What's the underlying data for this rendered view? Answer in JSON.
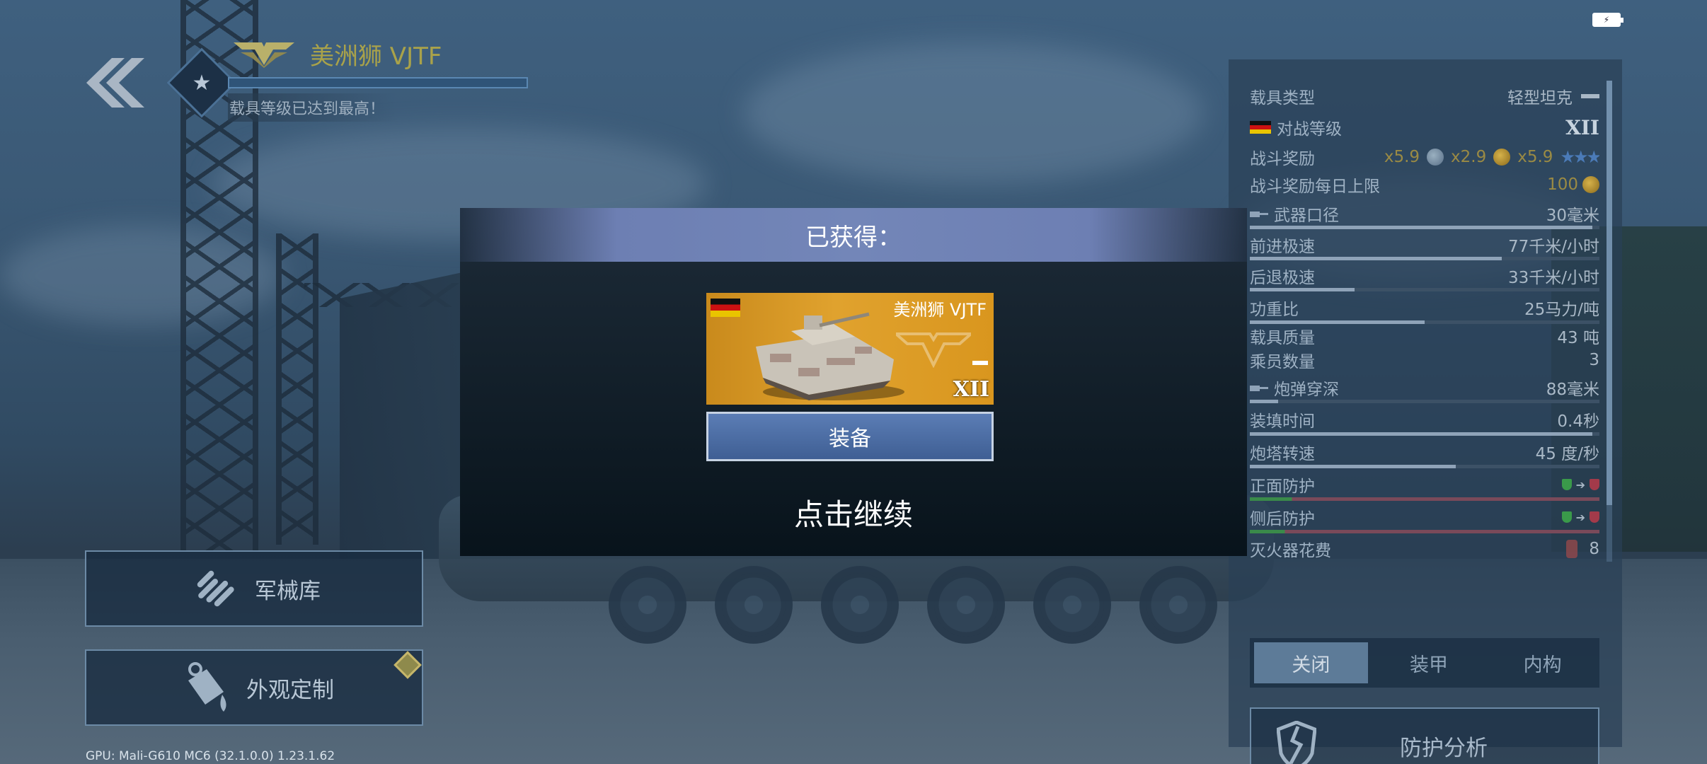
{
  "header": {
    "vehicle_name": "美洲狮 VJTF",
    "level_note": "载具等级已达到最高！"
  },
  "left_menu": {
    "arsenal_label": "军械库",
    "customize_label": "外观定制"
  },
  "gpu_info": "GPU: Mali-G610 MC6 (32.1.0.0)  1.23.1.62",
  "stats": {
    "vehicle_type": {
      "label": "载具类型",
      "value": "轻型坦克"
    },
    "battle_rating": {
      "label": "对战等级",
      "value": "XII"
    },
    "battle_reward": {
      "label": "战斗奖励",
      "silver": "x5.9",
      "gold": "x2.9",
      "research": "x5.9"
    },
    "daily_reward_cap": {
      "label": "战斗奖励每日上限",
      "value": "100"
    },
    "caliber": {
      "label": "武器口径",
      "value": "30毫米",
      "level": 0.98
    },
    "forward_speed": {
      "label": "前进极速",
      "value": "77千米/小时",
      "level": 0.72
    },
    "reverse_speed": {
      "label": "后退极速",
      "value": "33千米/小时",
      "level": 0.3
    },
    "power_ratio": {
      "label": "功重比",
      "value": "25马力/吨",
      "level": 0.5
    },
    "mass": {
      "label": "载具质量",
      "value": "43 吨"
    },
    "crew": {
      "label": "乘员数量",
      "value": "3"
    },
    "penetration": {
      "label": "炮弹穿深",
      "value": "88毫米",
      "level": 0.08
    },
    "reload": {
      "label": "装填时间",
      "value": "0.4秒",
      "level": 0.98
    },
    "turret_rotation": {
      "label": "炮塔转速",
      "value": "45 度/秒",
      "level": 0.59
    },
    "front_armor": {
      "label": "正面防护"
    },
    "side_armor": {
      "label": "侧后防护"
    },
    "extinguisher_cost": {
      "label": "灭火器花费",
      "value": "8"
    }
  },
  "view_toggle": {
    "options": [
      "关闭",
      "装甲",
      "内构"
    ],
    "selected": "关闭"
  },
  "protection_button_label": "防护分析",
  "modal": {
    "title": "已获得：",
    "card_name": "美洲狮 VJTF",
    "card_tier": "XII",
    "equip_label": "装备",
    "continue_label": "点击继续"
  },
  "colors": {
    "accent_blue": "#4f70a8",
    "modal_header": "#7386b8",
    "card_gold": "#e0a22e",
    "name_gold": "#a9a24a"
  }
}
